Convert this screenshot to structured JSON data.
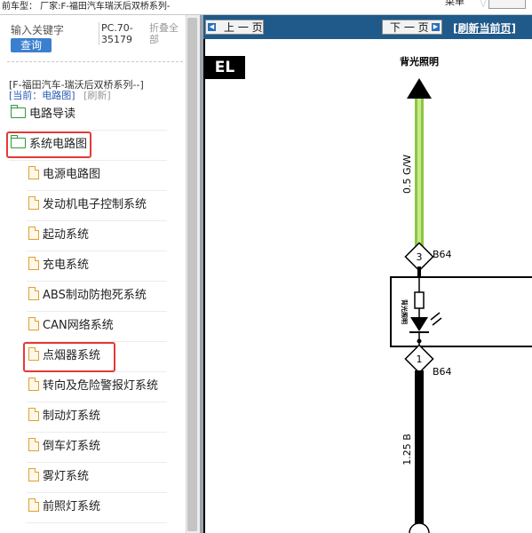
{
  "topbar": {
    "crumb": "前车型： 厂家:F-福田汽车瑞沃后双桥系列-",
    "menu_label": "菜单",
    "logo_faint": "VTU"
  },
  "search": {
    "keyword_label": "输入关键字",
    "query_button": "查询",
    "code": "PC.70-35179",
    "collapse_label": "折叠全部"
  },
  "tree": {
    "series": "[F-福田汽车-瑞沃后双桥系列--]",
    "current": "[当前：电路图]",
    "refresh": "[刷新]",
    "folders": [
      {
        "label": "电路导读",
        "highlight": false
      },
      {
        "label": "系统电路图",
        "highlight": true
      }
    ],
    "items": [
      {
        "label": "电源电路图",
        "highlight": false
      },
      {
        "label": "发动机电子控制系统",
        "highlight": false
      },
      {
        "label": "起动系统",
        "highlight": false
      },
      {
        "label": "充电系统",
        "highlight": false
      },
      {
        "label": "ABS制动防抱死系统",
        "highlight": false
      },
      {
        "label": "CAN网络系统",
        "highlight": false
      },
      {
        "label": "点烟器系统",
        "highlight": true
      },
      {
        "label": "转向及危险警报灯系统",
        "highlight": false
      },
      {
        "label": "制动灯系统",
        "highlight": false
      },
      {
        "label": "倒车灯系统",
        "highlight": false
      },
      {
        "label": "雾灯系统",
        "highlight": false
      },
      {
        "label": "前照灯系统",
        "highlight": false
      }
    ]
  },
  "viewer": {
    "prev_label": "上 一 页",
    "next_label": "下 一 页",
    "refresh_label": "[刷新当前页]",
    "section_badge": "EL"
  },
  "diagram": {
    "top_label": "背光照明",
    "wire_top": "0.5 G/W",
    "connector_top_pin": "3",
    "connector_top_name": "B64",
    "component_label": "背光照明",
    "connector_bottom_pin": "1",
    "connector_bottom_name": "B64",
    "wire_bottom": "1.25 B"
  },
  "colors": {
    "navbar": "#1f5a8a",
    "highlight_box": "#e53935",
    "wire_green": "#8cc63f",
    "folder_icon": "#2f9a3a"
  }
}
